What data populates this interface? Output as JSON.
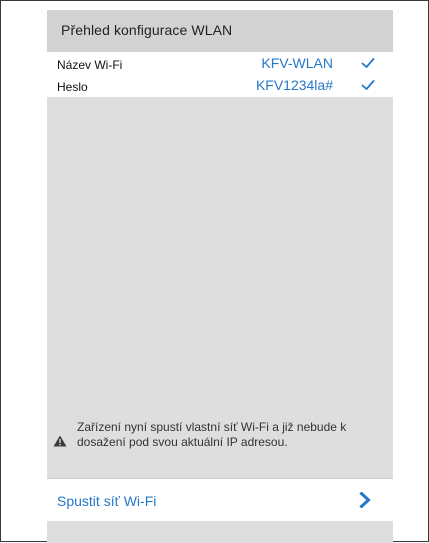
{
  "header": {
    "title": "Přehled konfigurace WLAN"
  },
  "settings": {
    "rows": [
      {
        "label": "Název Wi-Fi",
        "value": "KFV-WLAN",
        "status_icon": "checkmark-icon"
      },
      {
        "label": "Heslo",
        "value": "KFV1234la#",
        "status_icon": "checkmark-icon"
      }
    ]
  },
  "notice": {
    "icon": "warning-icon",
    "text": "Zařízení nyní spustí vlastní síť Wi-Fi a již nebude k dosažení pod svou aktuální IP adresou."
  },
  "action": {
    "label": "Spustit síť Wi-Fi",
    "icon": "chevron-right-icon"
  },
  "colors": {
    "accent": "#2577c8",
    "header_bg": "#d2d2d2",
    "panel_bg": "#dedede"
  }
}
